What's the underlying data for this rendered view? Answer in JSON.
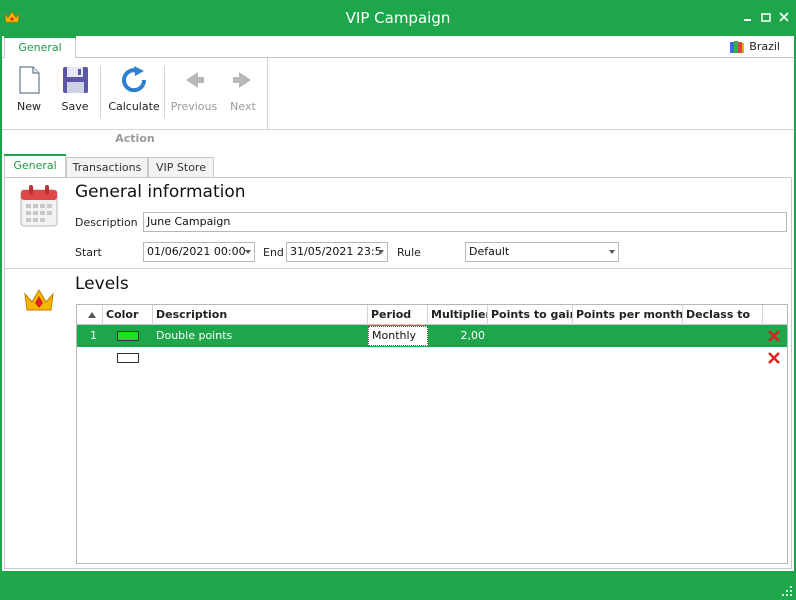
{
  "window": {
    "title": "VIP Campaign"
  },
  "ribbon": {
    "tab": "General",
    "region": "Brazil",
    "buttons": {
      "new": "New",
      "save": "Save",
      "calculate": "Calculate",
      "previous": "Previous",
      "next": "Next"
    },
    "group_label": "Action"
  },
  "tabs": [
    {
      "label": "General",
      "active": true
    },
    {
      "label": "Transactions",
      "active": false
    },
    {
      "label": "VIP Store",
      "active": false
    }
  ],
  "general_info": {
    "title": "General information",
    "description_label": "Description",
    "description_value": "June Campaign",
    "start_label": "Start",
    "start_value": "01/06/2021 00:00",
    "end_label": "End",
    "end_value": "31/05/2021 23:5",
    "rule_label": "Rule",
    "rule_value": "Default"
  },
  "levels": {
    "title": "Levels",
    "columns": [
      "Color",
      "Description",
      "Period",
      "Multiplier",
      "Points to gain",
      "Points per month",
      "Declass to"
    ],
    "rows": [
      {
        "index": "1",
        "color": "#22dd22",
        "description": "Double points",
        "period": "Monthly",
        "multiplier": "2,00",
        "points_to_gain": "",
        "points_per_month": "",
        "declass_to": ""
      },
      {
        "index": "",
        "color": "#ffffff",
        "description": "",
        "period": "",
        "multiplier": "",
        "points_to_gain": "",
        "points_per_month": "",
        "declass_to": ""
      }
    ]
  },
  "colors": {
    "accent": "#1ea64a",
    "delete": "#e02020"
  }
}
